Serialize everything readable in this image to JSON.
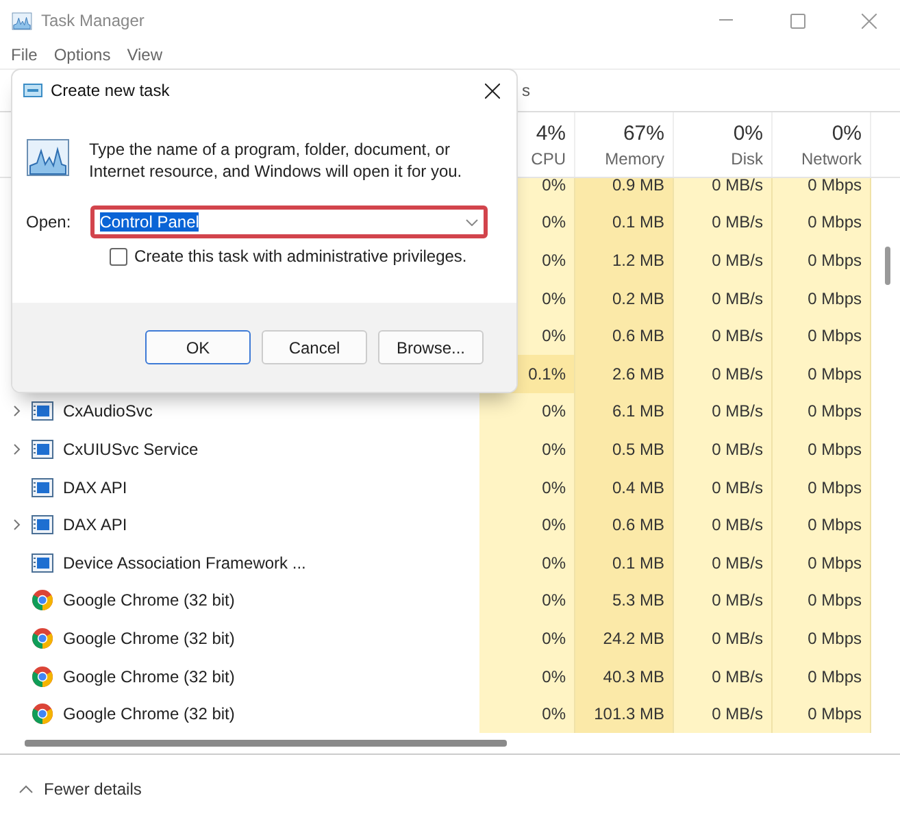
{
  "window": {
    "title": "Task Manager"
  },
  "menu": [
    "File",
    "Options",
    "View"
  ],
  "tabs": [
    {
      "label": "s"
    }
  ],
  "columns": [
    {
      "percent": "4%",
      "label": "CPU"
    },
    {
      "percent": "67%",
      "label": "Memory"
    },
    {
      "percent": "0%",
      "label": "Disk"
    },
    {
      "percent": "0%",
      "label": "Network"
    }
  ],
  "rows": [
    {
      "cpu": "0%",
      "cpu_high": false,
      "memory": "0.9 MB",
      "disk": "0 MB/s",
      "network": "0 Mbps"
    },
    {
      "cpu": "0%",
      "cpu_high": false,
      "memory": "0.1 MB",
      "disk": "0 MB/s",
      "network": "0 Mbps"
    },
    {
      "cpu": "0%",
      "cpu_high": false,
      "memory": "1.2 MB",
      "disk": "0 MB/s",
      "network": "0 Mbps"
    },
    {
      "cpu": "0%",
      "cpu_high": false,
      "memory": "0.2 MB",
      "disk": "0 MB/s",
      "network": "0 Mbps"
    },
    {
      "cpu": "0%",
      "cpu_high": false,
      "memory": "0.6 MB",
      "disk": "0 MB/s",
      "network": "0 Mbps"
    },
    {
      "cpu": "0.1%",
      "cpu_high": true,
      "memory": "2.6 MB",
      "disk": "0 MB/s",
      "network": "0 Mbps"
    },
    {
      "name": "CxAudioSvc",
      "kind": "service",
      "expandable": true,
      "cpu": "0%",
      "cpu_high": false,
      "memory": "6.1 MB",
      "disk": "0 MB/s",
      "network": "0 Mbps"
    },
    {
      "name": "CxUIUSvc Service",
      "kind": "service",
      "expandable": true,
      "cpu": "0%",
      "cpu_high": false,
      "memory": "0.5 MB",
      "disk": "0 MB/s",
      "network": "0 Mbps"
    },
    {
      "name": "DAX API",
      "kind": "service",
      "expandable": false,
      "cpu": "0%",
      "cpu_high": false,
      "memory": "0.4 MB",
      "disk": "0 MB/s",
      "network": "0 Mbps"
    },
    {
      "name": "DAX API",
      "kind": "service",
      "expandable": true,
      "cpu": "0%",
      "cpu_high": false,
      "memory": "0.6 MB",
      "disk": "0 MB/s",
      "network": "0 Mbps"
    },
    {
      "name": "Device Association Framework ...",
      "kind": "service",
      "expandable": false,
      "cpu": "0%",
      "cpu_high": false,
      "memory": "0.1 MB",
      "disk": "0 MB/s",
      "network": "0 Mbps"
    },
    {
      "name": "Google Chrome (32 bit)",
      "kind": "chrome",
      "expandable": false,
      "cpu": "0%",
      "cpu_high": false,
      "memory": "5.3 MB",
      "disk": "0 MB/s",
      "network": "0 Mbps"
    },
    {
      "name": "Google Chrome (32 bit)",
      "kind": "chrome",
      "expandable": false,
      "cpu": "0%",
      "cpu_high": false,
      "memory": "24.2 MB",
      "disk": "0 MB/s",
      "network": "0 Mbps"
    },
    {
      "name": "Google Chrome (32 bit)",
      "kind": "chrome",
      "expandable": false,
      "cpu": "0%",
      "cpu_high": false,
      "memory": "40.3 MB",
      "disk": "0 MB/s",
      "network": "0 Mbps"
    },
    {
      "name": "Google Chrome (32 bit)",
      "kind": "chrome",
      "expandable": false,
      "cpu": "0%",
      "cpu_high": false,
      "memory": "101.3 MB",
      "disk": "0 MB/s",
      "network": "0 Mbps"
    }
  ],
  "footer": {
    "label": "Fewer details"
  },
  "dialog": {
    "title": "Create new task",
    "message": "Type the name of a program, folder, document, or Internet resource, and Windows will open it for you.",
    "open_label": "Open:",
    "open_value": "Control Panel",
    "value_selected": true,
    "outlined": true,
    "admin_checkbox": {
      "label": "Create this task with administrative privileges.",
      "checked": false
    },
    "buttons": [
      {
        "label": "OK",
        "default": true
      },
      {
        "label": "Cancel",
        "default": false
      },
      {
        "label": "Browse...",
        "default": false
      }
    ]
  }
}
